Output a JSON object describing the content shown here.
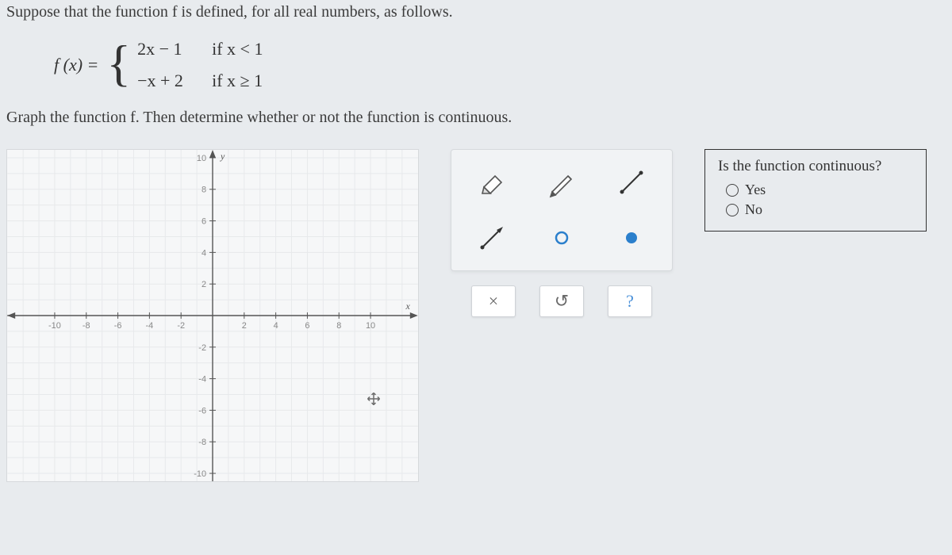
{
  "intro": "Suppose that the function f is defined, for all real numbers, as follows.",
  "function": {
    "lhs": "f (x) =",
    "pieces": [
      {
        "expr": "2x − 1",
        "cond": "if x < 1"
      },
      {
        "expr": "−x + 2",
        "cond": "if x ≥ 1"
      }
    ]
  },
  "instruction": "Graph the function f. Then determine whether or not the function is continuous.",
  "graph": {
    "x_ticks": [
      "-10",
      "-8",
      "-6",
      "-4",
      "-2",
      "2",
      "4",
      "6",
      "8",
      "10"
    ],
    "y_ticks": [
      "10",
      "8",
      "6",
      "4",
      "2",
      "-2",
      "-4",
      "-6",
      "-8",
      "-10"
    ],
    "x_axis_label": "x",
    "y_axis_label": "y"
  },
  "tools": {
    "eraser": "eraser",
    "pencil": "pencil",
    "segment": "segment",
    "ray": "ray",
    "open_point": "open-point",
    "closed_point": "closed-point"
  },
  "actions": {
    "clear": "×",
    "undo": "↺",
    "help": "?"
  },
  "question": {
    "title": "Is the function continuous?",
    "options": [
      "Yes",
      "No"
    ]
  }
}
